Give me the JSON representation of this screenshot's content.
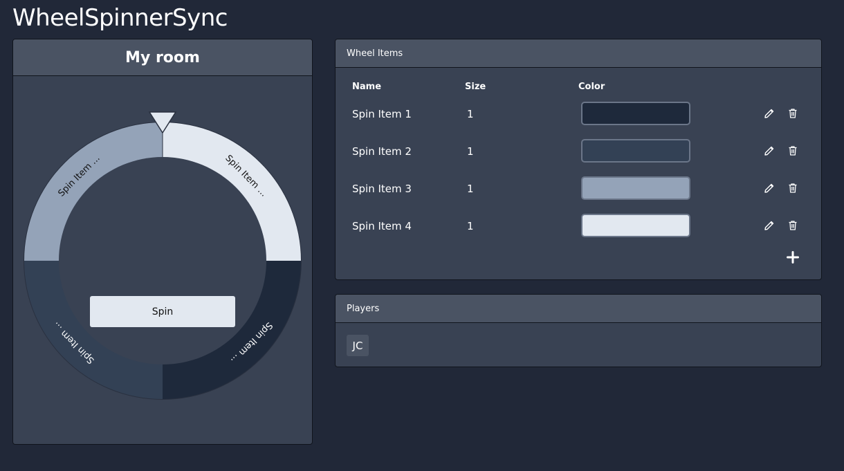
{
  "app": {
    "title": "WheelSpinnerSync"
  },
  "room": {
    "title": "My room",
    "spin_label": "Spin",
    "wheel_labels": [
      "Spin Item ...",
      "Spin Item ...",
      "Spin Item ...",
      "Spin Item ..."
    ]
  },
  "wheel_items": {
    "title": "Wheel Items",
    "columns": {
      "name": "Name",
      "size": "Size",
      "color": "Color"
    },
    "rows": [
      {
        "name": "Spin Item 1",
        "size": "1",
        "color": "#1e293b"
      },
      {
        "name": "Spin Item 2",
        "size": "1",
        "color": "#334155"
      },
      {
        "name": "Spin Item 3",
        "size": "1",
        "color": "#94a3b8"
      },
      {
        "name": "Spin Item 4",
        "size": "1",
        "color": "#e2e8f0"
      }
    ],
    "edit_icon": "pencil-icon",
    "delete_icon": "trash-icon",
    "add_icon": "plus-icon"
  },
  "players": {
    "title": "Players",
    "list": [
      {
        "initials": "JC"
      }
    ]
  },
  "colors": {
    "background": "#212838",
    "panel": "#394253",
    "panel_header": "#4a5363",
    "wheel_segment_top_left": "#94a3b8",
    "wheel_segment_top_right": "#e2e8f0",
    "wheel_segment_bottom_left": "#334155",
    "wheel_segment_bottom_right": "#1e293b"
  }
}
